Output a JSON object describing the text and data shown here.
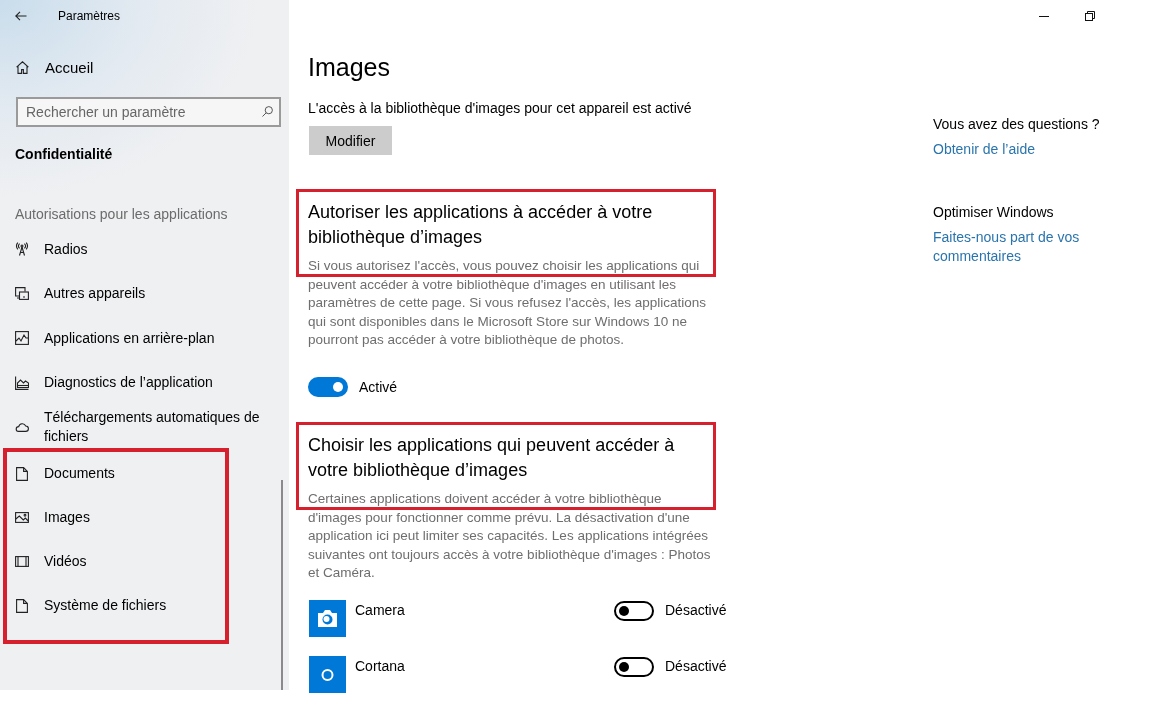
{
  "window": {
    "title": "Paramètres"
  },
  "sidebar": {
    "home": "Accueil",
    "search": {
      "placeholder": "Rechercher un paramètre"
    },
    "category": "Confidentialité",
    "group_label": "Autorisations pour les applications",
    "items": [
      {
        "label": "Radios",
        "highlighted": false
      },
      {
        "label": "Autres appareils",
        "highlighted": false
      },
      {
        "label": "Applications en arrière-plan",
        "highlighted": false
      },
      {
        "label": "Diagnostics de l’application",
        "highlighted": false
      },
      {
        "label": "Téléchargements automatiques de fichiers",
        "highlighted": false
      },
      {
        "label": "Documents",
        "highlighted": true
      },
      {
        "label": "Images",
        "highlighted": true
      },
      {
        "label": "Vidéos",
        "highlighted": true
      },
      {
        "label": "Système de fichiers",
        "highlighted": true
      }
    ]
  },
  "main": {
    "title": "Images",
    "status": "L'accès à la bibliothèque d'images pour cet appareil est activé",
    "button": "Modifier",
    "sections": [
      {
        "heading": "Autoriser les applications à accéder à votre bibliothèque d’images",
        "description": "Si vous autorisez l'accès, vous pouvez choisir les applications qui peuvent accéder à votre bibliothèque d'images en utilisant les paramètres de cette page. Si vous refusez l'accès, les applications qui sont disponibles dans le Microsoft Store sur Windows 10 ne pourront pas accéder à votre bibliothèque de photos.",
        "highlighted": true,
        "toggle": {
          "on": true,
          "label": "Activé"
        }
      },
      {
        "heading": "Choisir les applications qui peuvent accéder à votre bibliothèque d’images",
        "description": "Certaines applications doivent accéder à votre bibliothèque d'images pour fonctionner comme prévu. La désactivation d'une application ici peut limiter ses capacités. Les applications intégrées suivantes ont toujours accès à votre bibliothèque d'images : Photos et Caméra.",
        "highlighted": true,
        "apps": [
          {
            "name": "Camera",
            "on": false,
            "state": "Désactivé"
          },
          {
            "name": "Cortana",
            "on": false,
            "state": "Désactivé"
          }
        ]
      }
    ]
  },
  "help": [
    {
      "heading": "Vous avez des questions ?",
      "link": "Obtenir de l’aide"
    },
    {
      "heading": "Optimiser Windows",
      "link": "Faites-nous part de vos commentaires"
    }
  ]
}
